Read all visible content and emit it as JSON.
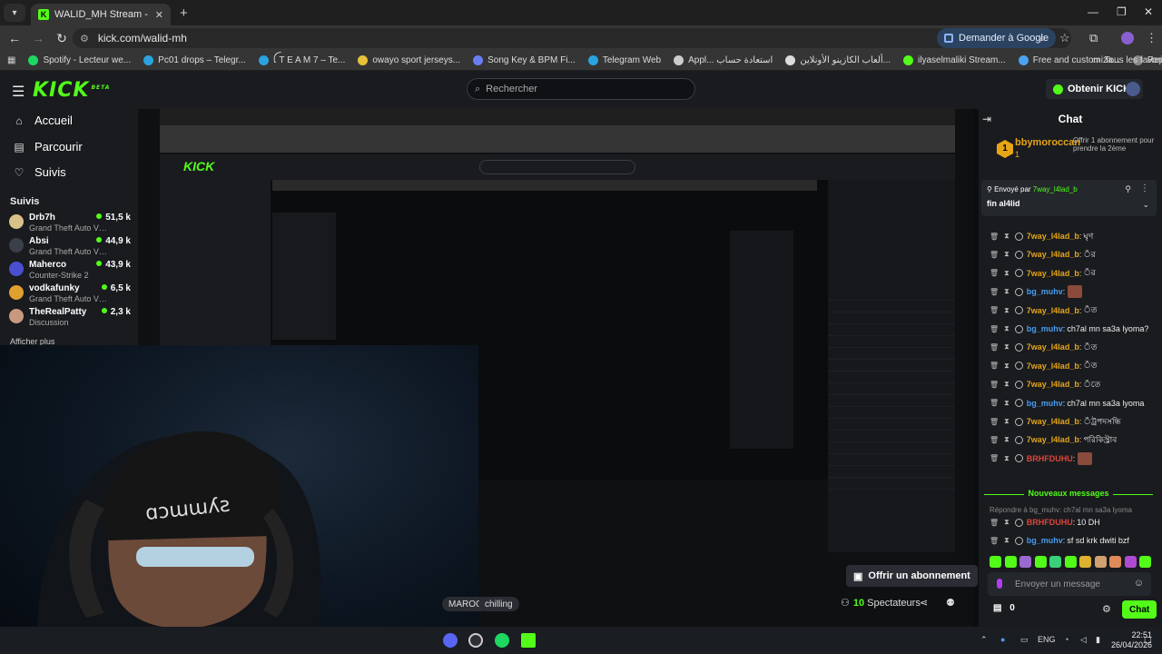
{
  "browser": {
    "tab_title": "WALID_MH Stream - Watch Live",
    "url": "kick.com/walid-mh",
    "google_btn": "Demander à Google",
    "bookmarks": [
      {
        "label": "Spotify - Lecteur we...",
        "color": "#1ed760"
      },
      {
        "label": "Pc01 drops – Telegr...",
        "color": "#2aa3e0"
      },
      {
        "label": "ꪶ T E A M 7 – Te...",
        "color": "#2aa3e0"
      },
      {
        "label": "owayo sport jerseys...",
        "color": "#e8c13a"
      },
      {
        "label": "Song Key & BPM Fi...",
        "color": "#6a7ef0"
      },
      {
        "label": "Telegram Web",
        "color": "#2aa3e0"
      },
      {
        "label": "Appl... استعادة حساب",
        "color": "#cccccc"
      },
      {
        "label": "ألعاب الكازينو الأونلاين...",
        "color": "#dddddd"
      },
      {
        "label": "ilyaselmaliki Stream...",
        "color": "#53fc18"
      },
      {
        "label": "Free and customiza...",
        "color": "#4aa3f0"
      },
      {
        "label": "Repack-Games - نج...",
        "color": "#888888"
      }
    ],
    "all_bookmarks": "Tous les favoris"
  },
  "kick": {
    "logo": "KICK",
    "logo_sup": "BETA",
    "search_placeholder": "Rechercher",
    "get_kicks": "Obtenir KICKs",
    "nav": [
      {
        "label": "Accueil",
        "icon": "⌂"
      },
      {
        "label": "Parcourir",
        "icon": "▤"
      },
      {
        "label": "Suivis",
        "icon": "♡"
      }
    ],
    "following_label": "Suivis",
    "channels": [
      {
        "name": "Drb7h",
        "game": "Grand Theft Auto V ...",
        "viewers": "51,5 k",
        "color": "#d9c28a"
      },
      {
        "name": "Absi",
        "game": "Grand Theft Auto V ...",
        "viewers": "44,9 k",
        "color": "#3a3f4a"
      },
      {
        "name": "Maherco",
        "game": "Counter-Strike 2",
        "viewers": "43,9 k",
        "color": "#4a4fd0"
      },
      {
        "name": "vodkafunky",
        "game": "Grand Theft Auto V l...",
        "viewers": "6,5 k",
        "color": "#e0a030"
      },
      {
        "name": "TheRealPatty",
        "game": "Discussion",
        "viewers": "2,3 k",
        "color": "#c79a80"
      }
    ],
    "show_more": "Afficher plus"
  },
  "stream": {
    "offer_sub": "Offrir un abonnement",
    "tags": [
      "MAROC",
      "chilling"
    ],
    "viewers_count": "10",
    "viewers_label": "Spectateurs"
  },
  "chat": {
    "title": "Chat",
    "subscriber": {
      "user": "bbymoroccan",
      "count": "1",
      "desc": "Offrir 1 abonnement pour prendre la 2ème"
    },
    "pinned": {
      "by_label": "Envoyé par",
      "by_user": "7way_l4lad_b",
      "message": "fin al4lid"
    },
    "messages": [
      {
        "user": "7way_l4lad_b",
        "color": "#e6a516",
        "text": "ঘৃণ"
      },
      {
        "user": "7way_l4lad_b",
        "color": "#e6a516",
        "text": "ঁর"
      },
      {
        "user": "7way_l4lad_b",
        "color": "#e6a516",
        "text": "ঁর"
      },
      {
        "user": "bg_muhv",
        "color": "#4a9cf0",
        "text": ""
      },
      {
        "user": "7way_l4lad_b",
        "color": "#e6a516",
        "text": "ঁত"
      },
      {
        "user": "bg_muhv",
        "color": "#4a9cf0",
        "text": "ch7al mn sa3a lyoma?"
      },
      {
        "user": "7way_l4lad_b",
        "color": "#e6a516",
        "text": "ঁত"
      },
      {
        "user": "7way_l4lad_b",
        "color": "#e6a516",
        "text": "ঁত"
      },
      {
        "user": "7way_l4lad_b",
        "color": "#e6a516",
        "text": "ঁতে"
      },
      {
        "user": "bg_muhv",
        "color": "#4a9cf0",
        "text": "ch7al mn sa3a lyoma"
      },
      {
        "user": "7way_l4lad_b",
        "color": "#e6a516",
        "text": "ঁট্রপদসন্ধি"
      },
      {
        "user": "7way_l4lad_b",
        "color": "#e6a516",
        "text": "পরিকিস্ট্রাব"
      },
      {
        "user": "BRHFDUHU",
        "color": "#e0443a",
        "text": ""
      }
    ],
    "new_messages": "Nouveaux messages",
    "reply_note": "Répondre à bg_muhv: ch7al mn sa3a lyoma",
    "messages_after": [
      {
        "user": "BRHFDUHU",
        "color": "#e0443a",
        "text": "10 DH"
      },
      {
        "user": "bg_muhv",
        "color": "#4a9cf0",
        "text": "sf sd krk dwiti bzf"
      }
    ],
    "input_placeholder": "Envoyer un message",
    "kicks_count": "0",
    "send_label": "Chat"
  },
  "taskbar": {
    "lang": "ENG",
    "time": "22:51",
    "date": "26/04/2026"
  }
}
